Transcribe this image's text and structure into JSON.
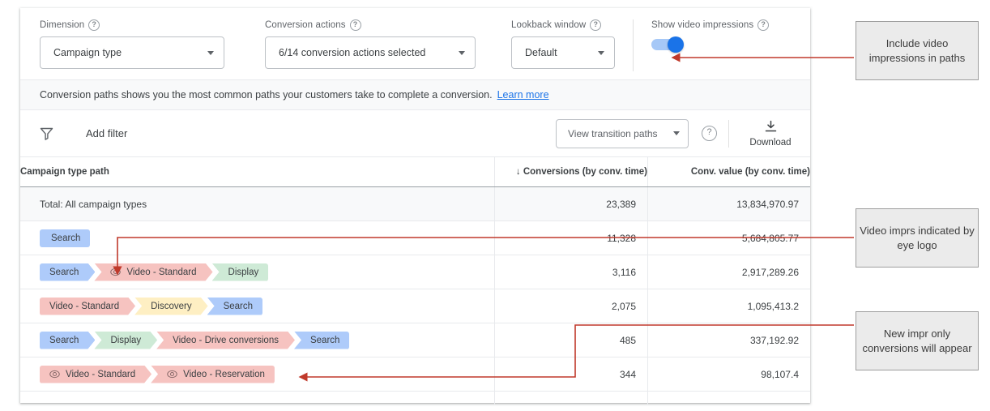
{
  "controls": {
    "dimension": {
      "label": "Dimension",
      "value": "Campaign type",
      "help_icon": "question-mark-icon"
    },
    "conversion_actions": {
      "label": "Conversion actions",
      "value": "6/14 conversion actions selected",
      "help_icon": "question-mark-icon"
    },
    "lookback_window": {
      "label": "Lookback window",
      "value": "Default",
      "help_icon": "question-mark-icon"
    },
    "show_video_impressions": {
      "label": "Show video impressions",
      "help_icon": "question-mark-icon",
      "state": "on",
      "on_color": "#1a73e8",
      "track_color": "#a6c8f7"
    }
  },
  "banner": {
    "text": "Conversion paths shows you the most common paths your customers take to complete a conversion.",
    "link_label": "Learn more",
    "link_color": "#1a73e8"
  },
  "filter_bar": {
    "filter_icon": "funnel-icon",
    "add_filter_label": "Add filter",
    "view_transition_paths_label": "View transition paths",
    "help_icon": "question-mark-icon",
    "download_label": "Download",
    "download_icon": "download-icon"
  },
  "table": {
    "columns": {
      "path": "Campaign type path",
      "conversions": "Conversions (by conv. time)",
      "conversions_sort_icon": "arrow-down-icon",
      "conv_value": "Conv. value (by conv. time)"
    },
    "total_row": {
      "label": "Total: All campaign types",
      "conversions": "23,389",
      "conv_value": "13,834,970.97"
    },
    "rows": [
      {
        "chips": [
          {
            "label": "Search",
            "color": "blue",
            "eye": false
          }
        ],
        "conversions": "11,328",
        "conv_value": "5,684,805.77"
      },
      {
        "chips": [
          {
            "label": "Search",
            "color": "blue",
            "eye": false
          },
          {
            "label": "Video - Standard",
            "color": "red",
            "eye": true
          },
          {
            "label": "Display",
            "color": "green",
            "eye": false
          }
        ],
        "conversions": "3,116",
        "conv_value": "2,917,289.26"
      },
      {
        "chips": [
          {
            "label": "Video - Standard",
            "color": "red",
            "eye": false
          },
          {
            "label": "Discovery",
            "color": "yellow",
            "eye": false
          },
          {
            "label": "Search",
            "color": "blue",
            "eye": false
          }
        ],
        "conversions": "2,075",
        "conv_value": "1,095,413.2"
      },
      {
        "chips": [
          {
            "label": "Search",
            "color": "blue",
            "eye": false
          },
          {
            "label": "Display",
            "color": "green",
            "eye": false
          },
          {
            "label": "Video - Drive conversions",
            "color": "red",
            "eye": false
          },
          {
            "label": "Search",
            "color": "blue",
            "eye": false
          }
        ],
        "conversions": "485",
        "conv_value": "337,192.92"
      },
      {
        "chips": [
          {
            "label": "Video - Standard",
            "color": "red",
            "eye": true
          },
          {
            "label": "Video - Reservation",
            "color": "red",
            "eye": true
          }
        ],
        "conversions": "344",
        "conv_value": "98,107.4"
      }
    ]
  },
  "annotations": {
    "color": "#c0392b",
    "callouts": [
      {
        "text": "Include video impressions in paths"
      },
      {
        "text": "Video imprs indicated by eye logo"
      },
      {
        "text": "New impr only conversions will appear"
      }
    ]
  },
  "chip_colors": {
    "blue": "#aecbfa",
    "red": "#f6c3c0",
    "green": "#ceead6",
    "yellow": "#feefc3"
  }
}
